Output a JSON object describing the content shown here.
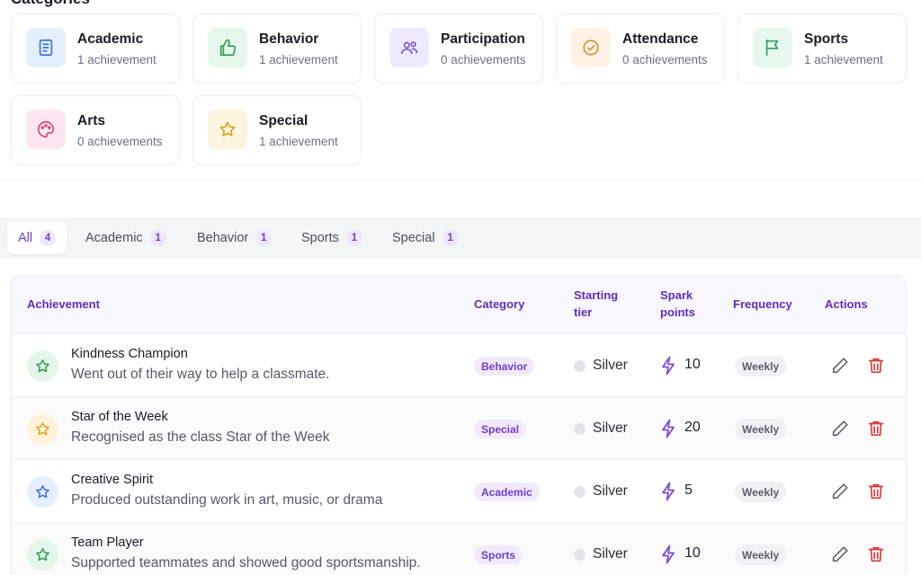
{
  "categories": {
    "title": "Categories",
    "items": [
      {
        "name": "Academic",
        "count": "1 achievement",
        "icon": "book-icon",
        "bg": "#e6efff",
        "color": "#3b6fd8"
      },
      {
        "name": "Behavior",
        "count": "1 achievement",
        "icon": "thumbs-up-icon",
        "bg": "#e5f7ea",
        "color": "#2f9e55"
      },
      {
        "name": "Participation",
        "count": "0 achievements",
        "icon": "users-icon",
        "bg": "#efe9fd",
        "color": "#7a55d6"
      },
      {
        "name": "Attendance",
        "count": "0 achievements",
        "icon": "check-circle-icon",
        "bg": "#fff1e3",
        "color": "#e0922e"
      },
      {
        "name": "Sports",
        "count": "1 achievement",
        "icon": "flag-icon",
        "bg": "#e6f7ee",
        "color": "#2f9e62"
      },
      {
        "name": "Arts",
        "count": "0 achievements",
        "icon": "palette-icon",
        "bg": "#fde6ef",
        "color": "#d9467c"
      },
      {
        "name": "Special",
        "count": "1 achievement",
        "icon": "star-icon",
        "bg": "#fdf4df",
        "color": "#d9a21f"
      }
    ]
  },
  "tabs": [
    {
      "label": "All",
      "count": "4",
      "active": true
    },
    {
      "label": "Academic",
      "count": "1"
    },
    {
      "label": "Behavior",
      "count": "1"
    },
    {
      "label": "Sports",
      "count": "1"
    },
    {
      "label": "Special",
      "count": "1"
    }
  ],
  "table": {
    "headers": {
      "achievement": "Achievement",
      "category": "Category",
      "starting_tier_1": "Starting",
      "starting_tier_2": "tier",
      "spark_1": "Spark",
      "spark_2": "points",
      "frequency": "Frequency",
      "actions": "Actions"
    },
    "rows": [
      {
        "title": "Kindness Champion",
        "desc": "Went out of their way to help a classmate.",
        "category": "Behavior",
        "tier": "Silver",
        "points": "10",
        "frequency": "Weekly",
        "star_bg": "#e4f6ea",
        "star_color": "#2f9e55"
      },
      {
        "title": "Star of the Week",
        "desc": "Recognised as the class Star of the Week",
        "category": "Special",
        "tier": "Silver",
        "points": "20",
        "frequency": "Weekly",
        "star_bg": "#fdf3da",
        "star_color": "#d9a21f"
      },
      {
        "title": "Creative Spirit",
        "desc": "Produced outstanding work in art, music, or drama",
        "category": "Academic",
        "tier": "Silver",
        "points": "5",
        "frequency": "Weekly",
        "star_bg": "#e5eeff",
        "star_color": "#3b6fd8"
      },
      {
        "title": "Team Player",
        "desc": "Supported teammates and showed good sportsmanship.",
        "category": "Sports",
        "tier": "Silver",
        "points": "10",
        "frequency": "Weekly",
        "star_bg": "#e4f6ea",
        "star_color": "#2f9e55"
      }
    ]
  },
  "colors": {
    "accent": "#6d3fd1",
    "delete": "#d93a3a",
    "bolt": "#7a4bd8"
  }
}
